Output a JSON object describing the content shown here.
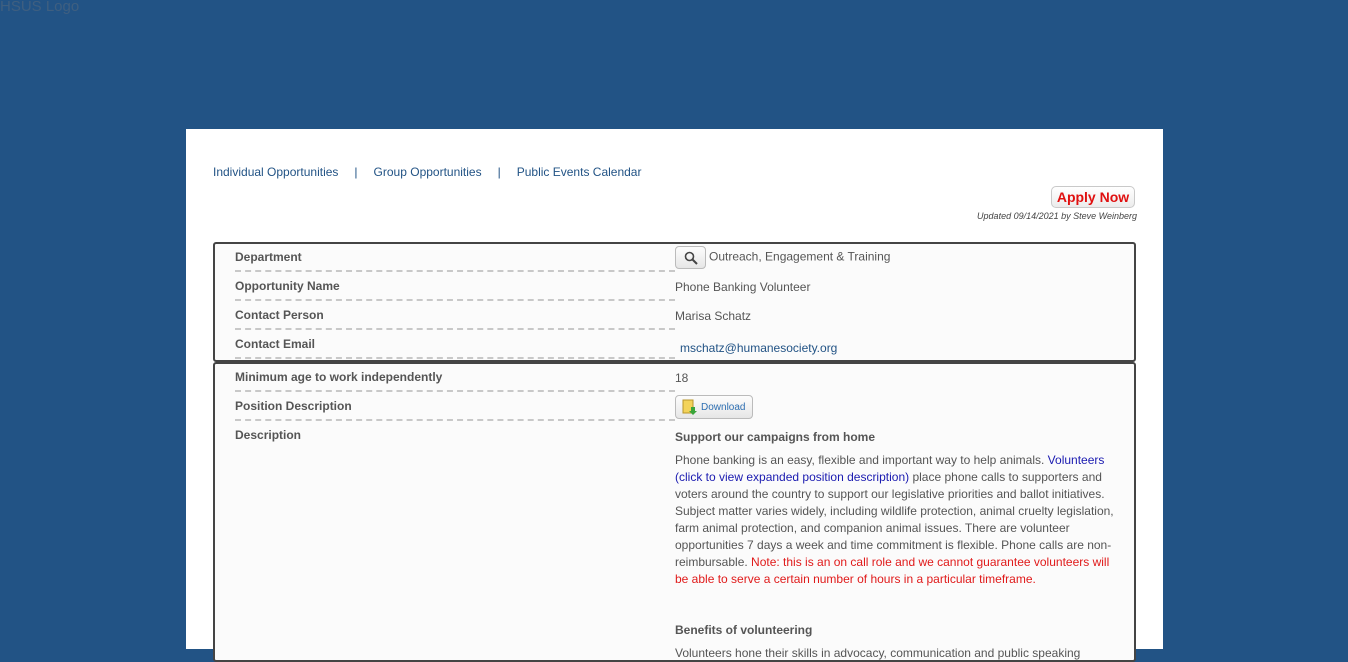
{
  "logo_alt": "HSUS Logo",
  "nav": {
    "individual": "Individual Opportunities",
    "separator": "|",
    "group": "Group Opportunities",
    "events": "Public Events Calendar"
  },
  "apply_label": "Apply Now",
  "updated_text": "Updated 09/14/2021 by Steve Weinberg",
  "fields": {
    "department_label": "Department",
    "department_value": "Outreach, Engagement & Training",
    "opportunity_label": "Opportunity Name",
    "opportunity_value": "Phone Banking Volunteer",
    "contact_label": "Contact Person",
    "contact_value": "Marisa Schatz",
    "email_label": "Contact Email",
    "email_value": "mschatz@humanesociety.org",
    "min_age_label": "Minimum age to work independently",
    "min_age_value": "18",
    "position_label": "Position Description",
    "download_label": "Download",
    "description_label": "Description"
  },
  "description": {
    "heading": "Support our campaigns from home",
    "p1_start": "Phone banking is an easy, flexible and important way to help animals. ",
    "p1_link": "Volunteers (click to view expanded position description)",
    "p1_rest": " place phone calls to supporters and voters around the country to support our legislative priorities and ballot initiatives. Subject matter varies widely, including wildlife protection, animal cruelty legislation, farm animal protection, and companion animal issues. There are volunteer opportunities 7 days a week and time commitment is flexible. Phone calls are non-reimbursable. ",
    "p1_note": "Note: this is an on call role and we cannot guarantee volunteers will be able to serve a certain number of hours in a particular timeframe.",
    "benefits_heading": "Benefits of volunteering",
    "benefits_start": "Volunteers hone their skills in advocacy, communication and public speaking"
  },
  "colors": {
    "page_bg": "#225385",
    "link": "#225385",
    "apply_red": "#e01010",
    "note_red": "#e01a1a"
  }
}
